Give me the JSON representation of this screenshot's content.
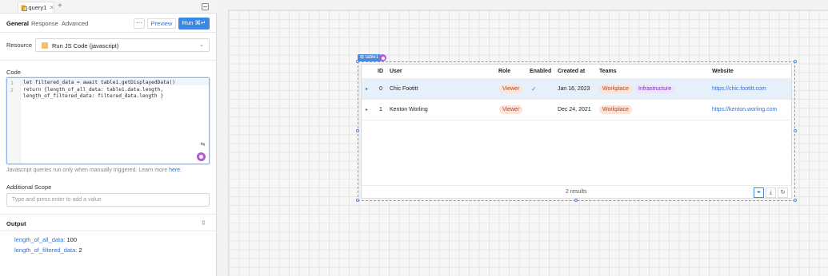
{
  "query_tab": {
    "name": "query1",
    "close": "×",
    "add": "+"
  },
  "subtabs": {
    "general": "General",
    "response": "Response",
    "advanced": "Advanced"
  },
  "toolbar": {
    "more": "···",
    "preview": "Preview",
    "run": "Run ⌘↵"
  },
  "resource": {
    "label": "Resource",
    "value": "Run JS Code (javascript)",
    "chevron": "⌄"
  },
  "code": {
    "label": "Code",
    "line_numbers": [
      "1",
      "2"
    ],
    "lines": [
      "let filtered_data = await table1.getDisplayedData()",
      "return {length_of_all_data: table1.data.length,",
      "length_of_filtered_data: filtered_data.length }"
    ]
  },
  "hint": {
    "text": "Javascript queries run only when manually triggered. Learn more ",
    "link": "here",
    "end": "."
  },
  "scope": {
    "label": "Additional Scope",
    "placeholder": "Type and press enter to add a value"
  },
  "output": {
    "label": "Output",
    "toggle": "⇳",
    "rows": [
      {
        "key": "length_of_all_data:",
        "value": "100"
      },
      {
        "key": "length_of_filtered_data:",
        "value": "2"
      }
    ]
  },
  "component": {
    "tag": "⊞ table1"
  },
  "table": {
    "columns": [
      "ID",
      "User",
      "Role",
      "Enabled",
      "Created at",
      "Teams",
      "Website"
    ],
    "rows": [
      {
        "id": "0",
        "user": "Chic Footitt",
        "role": "Viewer",
        "enabled": "✓",
        "created": "Jan 16, 2023",
        "teams": [
          "Workplace",
          "Infrastructure"
        ],
        "website": "https://chic.footitt.com"
      },
      {
        "id": "1",
        "user": "Kenton Worling",
        "role": "Viewer",
        "enabled": "",
        "created": "Dec 24, 2021",
        "teams": [
          "Workplace"
        ],
        "website": "https://kenton.worling.com"
      }
    ],
    "footer": "2 results",
    "tools": {
      "filter": "⏷",
      "download": "⤓",
      "refresh": "↻"
    }
  }
}
